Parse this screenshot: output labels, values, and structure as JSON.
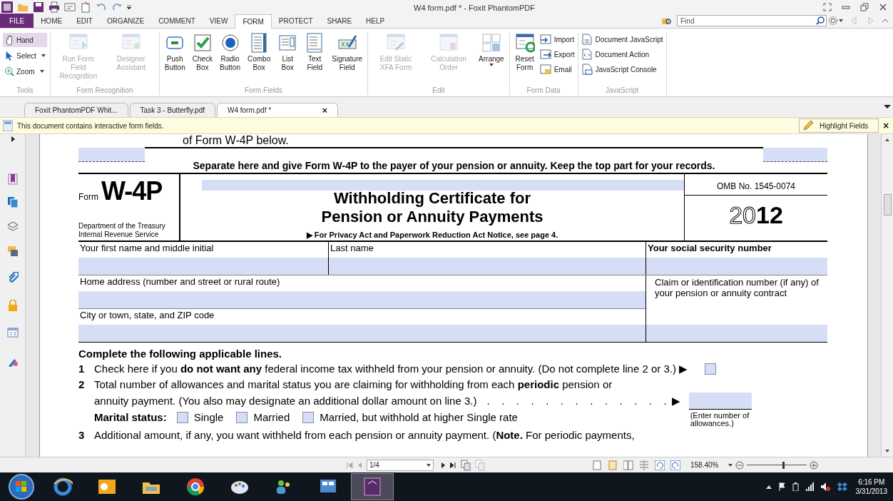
{
  "window": {
    "title": "W4 form.pdf * - Foxit PhantomPDF"
  },
  "ribbon_tabs": [
    {
      "label": "FILE",
      "kind": "file",
      "selected": false
    },
    {
      "label": "HOME",
      "kind": "tab",
      "selected": false
    },
    {
      "label": "EDIT",
      "kind": "tab",
      "selected": false
    },
    {
      "label": "ORGANIZE",
      "kind": "tab",
      "selected": false
    },
    {
      "label": "COMMENT",
      "kind": "tab",
      "selected": false
    },
    {
      "label": "VIEW",
      "kind": "tab",
      "selected": false
    },
    {
      "label": "FORM",
      "kind": "tab",
      "selected": true
    },
    {
      "label": "PROTECT",
      "kind": "tab",
      "selected": false
    },
    {
      "label": "SHARE",
      "kind": "tab",
      "selected": false
    },
    {
      "label": "HELP",
      "kind": "tab",
      "selected": false
    }
  ],
  "search": {
    "placeholder": "Find"
  },
  "ribbon_groups": [
    {
      "label": "Tools",
      "kind": "tools",
      "items": [
        {
          "label": "Hand",
          "selected": true
        },
        {
          "label": "Select",
          "selected": false,
          "dropdown": true
        },
        {
          "label": "Zoom",
          "selected": false,
          "dropdown": true
        }
      ]
    },
    {
      "label": "Form Recognition",
      "kind": "large",
      "items": [
        {
          "label": "Run Form Field Recognition",
          "disabled": true
        },
        {
          "label": "Designer Assistant",
          "disabled": true
        }
      ]
    },
    {
      "label": "Form Fields",
      "kind": "large",
      "items": [
        {
          "label": "Push Button",
          "disabled": false
        },
        {
          "label": "Check Box",
          "disabled": false
        },
        {
          "label": "Radio Button",
          "disabled": false
        },
        {
          "label": "Combo Box",
          "disabled": false
        },
        {
          "label": "List Box",
          "disabled": false
        },
        {
          "label": "Text Field",
          "disabled": false
        },
        {
          "label": "Signature Field",
          "disabled": false
        }
      ]
    },
    {
      "label": "Edit",
      "kind": "large",
      "items": [
        {
          "label": "Edit Static XFA Form",
          "disabled": true
        },
        {
          "label": "Calculation Order",
          "disabled": true
        },
        {
          "label": "Arrange",
          "disabled": false,
          "dropdown": true
        }
      ]
    },
    {
      "label": "Form Data",
      "kind": "mixed",
      "items": [
        {
          "label": "Reset Form",
          "disabled": false
        }
      ],
      "small_items": [
        "Import",
        "Export",
        "Email"
      ]
    },
    {
      "label": "JavaScript",
      "kind": "list",
      "small_items": [
        "Document JavaScript",
        "Document Action",
        "JavaScript Console"
      ]
    }
  ],
  "doc_tabs": [
    {
      "label": "Foxit PhantomPDF Whit...",
      "selected": false
    },
    {
      "label": "Task 3 - Butterfly.pdf",
      "selected": false
    },
    {
      "label": "W4 form.pdf *",
      "selected": true,
      "close": "×"
    }
  ],
  "message_bar": {
    "text": "This document contains interactive form fields.",
    "button": "Highlight Fields",
    "close": "×"
  },
  "form": {
    "top_text": "of Form W-4P below.",
    "separator": "Separate here and give Form W-4P to the payer of your pension or annuity. Keep the top part for your records.",
    "form_word": "Form",
    "form_number": "W-4P",
    "department": [
      "Department of the Treasury",
      "Internal Revenue Service"
    ],
    "title": [
      "Withholding Certificate for",
      "Pension or Annuity Payments"
    ],
    "notice": "▶ For Privacy Act and Paperwork Reduction Act Notice, see page 4.",
    "omb": "OMB No. 1545-0074",
    "year": "2012",
    "fields": {
      "first_name": "Your first name and middle initial",
      "last_name": "Last name",
      "ssn": "Your social security number",
      "address": "Home address (number and street or rural route)",
      "claim": "Claim or identification number (if any) of your pension or annuity contract",
      "city": "City or town, state, and ZIP code"
    },
    "lines_heading": "Complete the following applicable lines.",
    "line1": {
      "number": "1",
      "text": "Check here if you **do not want any** federal income tax withheld from your pension or annuity. (Do not complete line 2 or 3.) ▶",
      "checked": false
    },
    "line2": {
      "number": "2",
      "text": "Total number of allowances and marital status you are claiming for withholding from each **periodic** pension or",
      "text2": "annuity payment. (You also may designate an additional dollar amount on line 3.)",
      "leader": ".   .   .   .   .   .   .   .   .   .   .   .   .",
      "arrow": "▶",
      "note": "(Enter number of allowances.)",
      "marital_label": "Marital status:",
      "marital_options": [
        {
          "label": "Single",
          "checked": false
        },
        {
          "label": "Married",
          "checked": false
        },
        {
          "label": "Married, but withhold at higher Single rate",
          "checked": false
        }
      ]
    },
    "line3": {
      "number": "3",
      "text": "Additional amount, if any, you want withheld from each pension or annuity payment. (**Note.** For periodic payments,"
    }
  },
  "navigation": {
    "page": "1/4"
  },
  "zoom": {
    "value": "158.40%",
    "level": 0.6
  },
  "taskbar": {
    "time": "6:16 PM",
    "date": "3/31/2013"
  }
}
